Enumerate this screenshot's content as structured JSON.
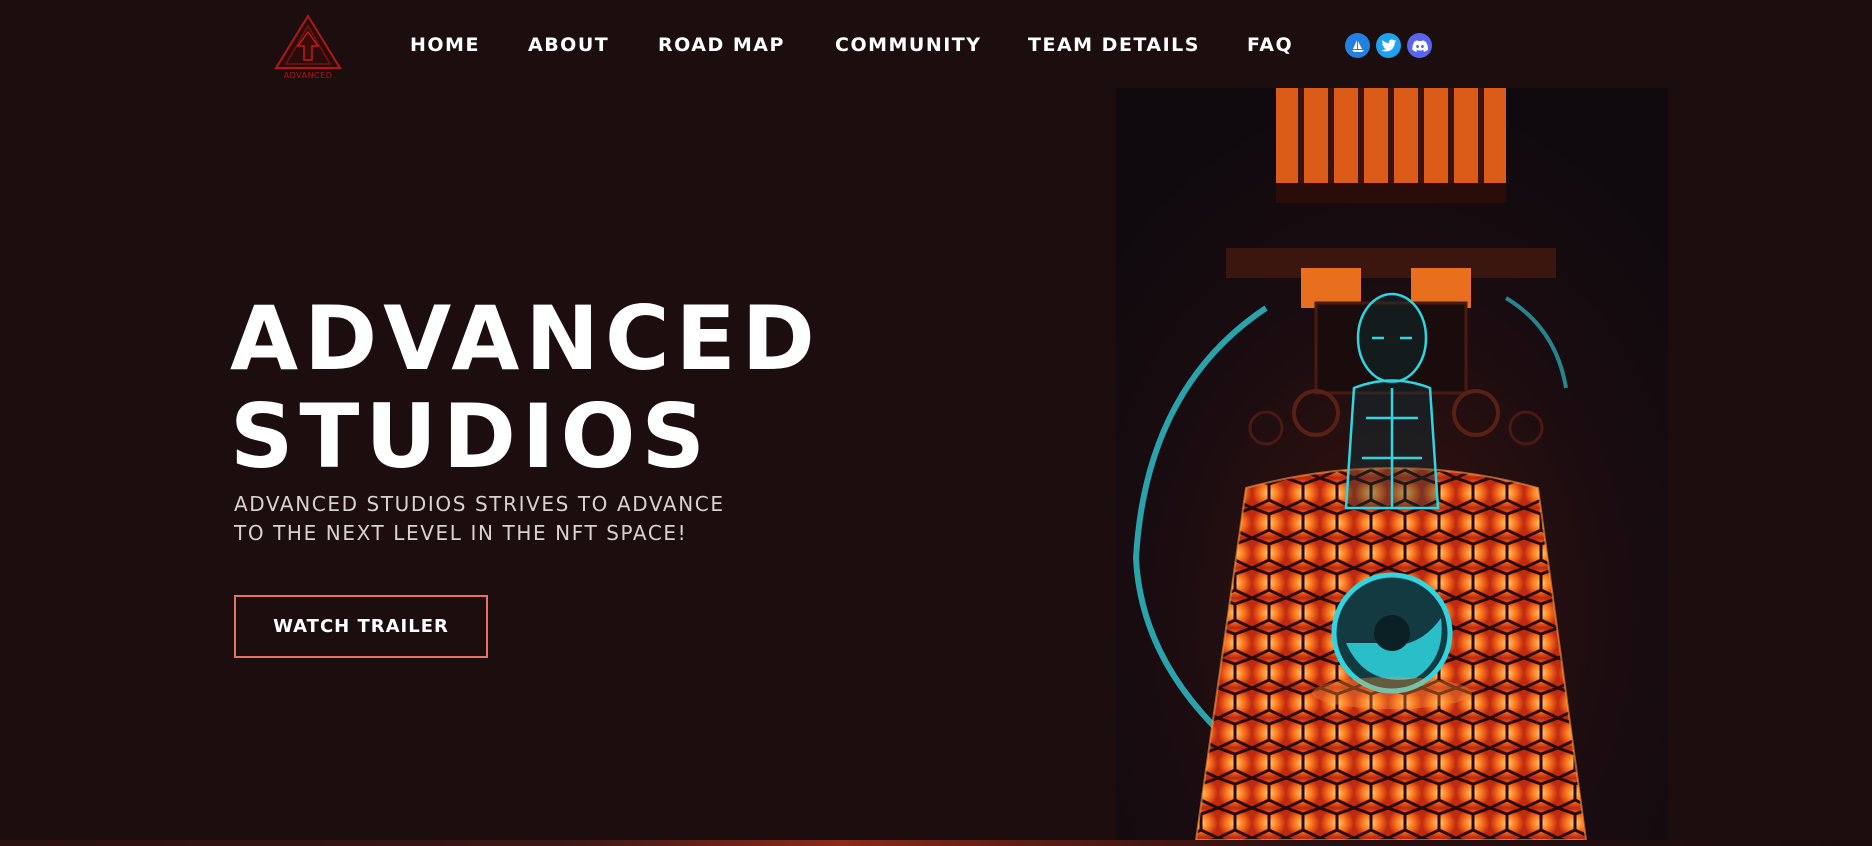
{
  "brand": {
    "logo_text": "ADVANCED",
    "logo_color": "#b01818"
  },
  "nav": {
    "items": [
      {
        "label": "HOME"
      },
      {
        "label": "ABOUT"
      },
      {
        "label": "ROAD MAP"
      },
      {
        "label": "COMMUNITY"
      },
      {
        "label": "TEAM DETAILS"
      },
      {
        "label": "FAQ"
      }
    ]
  },
  "socials": [
    {
      "icon": "opensea-icon",
      "color": "#2081e2"
    },
    {
      "icon": "twitter-icon",
      "color": "#1da1f2"
    },
    {
      "icon": "discord-icon",
      "color": "#5865f2"
    }
  ],
  "hero": {
    "title_line1": "ADVANCED",
    "title_line2": "STUDIOS",
    "subtitle_line1": "ADVANCED STUDIOS STRIVES TO ADVANCE",
    "subtitle_line2": "TO THE NEXT LEVEL IN THE NFT SPACE!",
    "button_label": "WATCH TRAILER",
    "button_border_color": "#e77368"
  },
  "colors": {
    "background": "#1c0e0e",
    "accent_orange": "#ff6a1a",
    "accent_cyan": "#2fd6e0"
  }
}
